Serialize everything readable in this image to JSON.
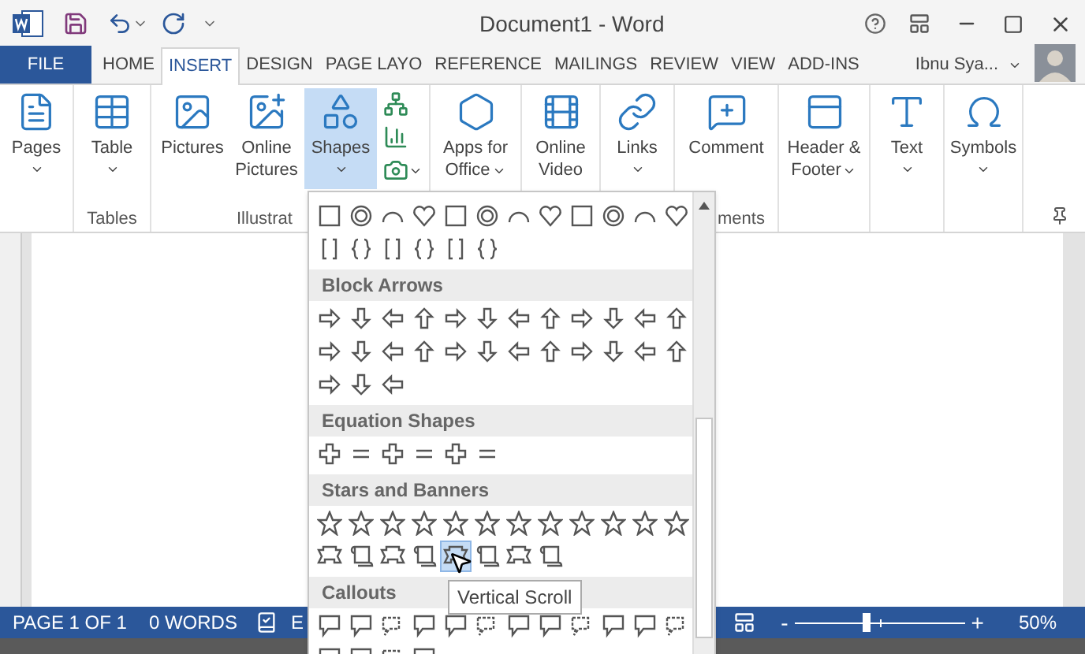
{
  "window": {
    "title": "Document1 - Word"
  },
  "ribbon_tabs": [
    {
      "label": "FILE",
      "kind": "file",
      "selected": false
    },
    {
      "label": "HOME",
      "kind": "tab",
      "selected": false
    },
    {
      "label": "INSERT",
      "kind": "tab",
      "selected": true
    },
    {
      "label": "DESIGN",
      "kind": "tab",
      "selected": false
    },
    {
      "label": "PAGE LAYO",
      "kind": "tab",
      "selected": false
    },
    {
      "label": "REFERENCE",
      "kind": "tab",
      "selected": false
    },
    {
      "label": "MAILINGS",
      "kind": "tab",
      "selected": false
    },
    {
      "label": "REVIEW",
      "kind": "tab",
      "selected": false
    },
    {
      "label": "VIEW",
      "kind": "tab",
      "selected": false
    },
    {
      "label": "ADD-INS",
      "kind": "tab",
      "selected": false
    }
  ],
  "account": {
    "name": "Ibnu Sya..."
  },
  "ribbon_groups": [
    {
      "buttons": [
        {
          "kind": "large",
          "label": "Pages",
          "dropdown": true,
          "selected": false
        }
      ]
    },
    {
      "label": "Tables",
      "buttons": [
        {
          "kind": "large",
          "label": "Table",
          "dropdown": true,
          "selected": false
        }
      ]
    },
    {
      "label": "Illustrat",
      "buttons": [
        {
          "kind": "large",
          "label": "Pictures",
          "dropdown": false,
          "selected": false
        },
        {
          "kind": "large",
          "label": "Online Pictures",
          "dropdown": false,
          "selected": false
        },
        {
          "kind": "large",
          "label": "Shapes",
          "dropdown": true,
          "selected": true
        },
        {
          "kind": "small",
          "dropdown": false,
          "selected": false
        },
        {
          "kind": "small",
          "dropdown": false,
          "selected": false
        },
        {
          "kind": "small",
          "dropdown": true,
          "selected": false
        }
      ]
    },
    {
      "buttons": [
        {
          "kind": "wrapped",
          "label": "Apps for Office",
          "dropdown": true,
          "selected": false
        }
      ]
    },
    {
      "buttons": [
        {
          "kind": "large",
          "label": "Online Video",
          "dropdown": false,
          "selected": false
        }
      ]
    },
    {
      "buttons": [
        {
          "kind": "large",
          "label": "Links",
          "dropdown": true,
          "selected": false
        }
      ]
    },
    {
      "label": "ments",
      "buttons": [
        {
          "kind": "large",
          "label": "Comment",
          "dropdown": false,
          "selected": false
        }
      ]
    },
    {
      "buttons": [
        {
          "kind": "wrapped",
          "label": "Header & Footer",
          "dropdown": true,
          "selected": false
        }
      ]
    },
    {
      "buttons": [
        {
          "kind": "large",
          "label": "Text",
          "dropdown": true,
          "selected": false
        }
      ]
    },
    {
      "buttons": [
        {
          "kind": "large",
          "label": "Symbols",
          "dropdown": true,
          "selected": false
        }
      ]
    }
  ],
  "shape_gallery": {
    "sections": [
      {
        "rows": [
          [
            {
              "kind": "basic",
              "selected": false
            },
            {
              "kind": "basic",
              "selected": false
            },
            {
              "kind": "basic",
              "selected": false
            },
            {
              "kind": "basic",
              "selected": false
            },
            {
              "kind": "basic",
              "selected": false
            },
            {
              "kind": "basic",
              "selected": false
            },
            {
              "kind": "basic",
              "selected": false
            },
            {
              "kind": "basic",
              "selected": false
            },
            {
              "kind": "basic",
              "selected": false
            },
            {
              "kind": "basic",
              "selected": false
            },
            {
              "kind": "basic",
              "selected": false
            },
            {
              "kind": "basic",
              "selected": false
            }
          ],
          [
            {
              "kind": "bracket",
              "selected": false
            },
            {
              "kind": "bracket",
              "selected": false
            },
            {
              "kind": "bracket",
              "selected": false
            },
            {
              "kind": "bracket",
              "selected": false
            },
            {
              "kind": "bracket",
              "selected": false
            },
            {
              "kind": "bracket",
              "selected": false
            }
          ]
        ]
      },
      {
        "title": "Block Arrows",
        "rows": [
          [
            {
              "kind": "arrow",
              "selected": false
            },
            {
              "kind": "arrow",
              "selected": false
            },
            {
              "kind": "arrow",
              "selected": false
            },
            {
              "kind": "arrow",
              "selected": false
            },
            {
              "kind": "arrow",
              "selected": false
            },
            {
              "kind": "arrow",
              "selected": false
            },
            {
              "kind": "arrow",
              "selected": false
            },
            {
              "kind": "arrow",
              "selected": false
            },
            {
              "kind": "arrow",
              "selected": false
            },
            {
              "kind": "arrow",
              "selected": false
            },
            {
              "kind": "arrow",
              "selected": false
            },
            {
              "kind": "arrow",
              "selected": false
            }
          ],
          [
            {
              "kind": "arrow",
              "selected": false
            },
            {
              "kind": "arrow",
              "selected": false
            },
            {
              "kind": "arrow",
              "selected": false
            },
            {
              "kind": "arrow",
              "selected": false
            },
            {
              "kind": "arrow",
              "selected": false
            },
            {
              "kind": "arrow",
              "selected": false
            },
            {
              "kind": "arrow",
              "selected": false
            },
            {
              "kind": "arrow",
              "selected": false
            },
            {
              "kind": "arrow",
              "selected": false
            },
            {
              "kind": "arrow",
              "selected": false
            },
            {
              "kind": "arrow",
              "selected": false
            },
            {
              "kind": "arrow",
              "selected": false
            }
          ],
          [
            {
              "kind": "arrow",
              "selected": false
            },
            {
              "kind": "arrow",
              "selected": false
            },
            {
              "kind": "arrow",
              "selected": false
            }
          ]
        ]
      },
      {
        "title": "Equation Shapes",
        "rows": [
          [
            {
              "kind": "math",
              "selected": false
            },
            {
              "kind": "math",
              "selected": false
            },
            {
              "kind": "math",
              "selected": false
            },
            {
              "kind": "math",
              "selected": false
            },
            {
              "kind": "math",
              "selected": false
            },
            {
              "kind": "math",
              "selected": false
            }
          ]
        ]
      },
      {
        "title": "Stars and Banners",
        "rows": [
          [
            {
              "kind": "star",
              "selected": false
            },
            {
              "kind": "star",
              "selected": false
            },
            {
              "kind": "star",
              "selected": false
            },
            {
              "kind": "star",
              "selected": false
            },
            {
              "kind": "star",
              "selected": false
            },
            {
              "kind": "star",
              "selected": false
            },
            {
              "kind": "star",
              "selected": false
            },
            {
              "kind": "star",
              "selected": false
            },
            {
              "kind": "star",
              "selected": false
            },
            {
              "kind": "star",
              "selected": false
            },
            {
              "kind": "star",
              "selected": false
            },
            {
              "kind": "star",
              "selected": false
            }
          ],
          [
            {
              "kind": "banner",
              "selected": false
            },
            {
              "kind": "banner",
              "selected": false
            },
            {
              "kind": "banner",
              "selected": false
            },
            {
              "kind": "banner",
              "selected": false
            },
            {
              "kind": "banner",
              "selected": true
            },
            {
              "kind": "banner",
              "selected": false
            },
            {
              "kind": "banner",
              "selected": false
            },
            {
              "kind": "banner",
              "selected": false
            }
          ]
        ]
      },
      {
        "title": "Callouts",
        "rows": [
          [
            {
              "kind": "callout",
              "selected": false
            },
            {
              "kind": "callout",
              "selected": false
            },
            {
              "kind": "callout",
              "selected": false
            },
            {
              "kind": "callout",
              "selected": false
            },
            {
              "kind": "callout",
              "selected": false
            },
            {
              "kind": "callout",
              "selected": false
            },
            {
              "kind": "callout",
              "selected": false
            },
            {
              "kind": "callout",
              "selected": false
            },
            {
              "kind": "callout",
              "selected": false
            },
            {
              "kind": "callout",
              "selected": false
            },
            {
              "kind": "callout",
              "selected": false
            },
            {
              "kind": "callout",
              "selected": false
            }
          ],
          [
            {
              "kind": "callout",
              "selected": false
            },
            {
              "kind": "callout",
              "selected": false
            },
            {
              "kind": "callout",
              "selected": false
            },
            {
              "kind": "callout",
              "selected": false
            }
          ]
        ]
      }
    ]
  },
  "tooltip": {
    "text": "Vertical Scroll"
  },
  "status_bar": {
    "page": "PAGE 1 OF 1",
    "words": "0 WORDS",
    "language": "E",
    "zoom_out": "-",
    "zoom_in": "+",
    "zoom": {
      "level": 0.42
    },
    "zoom_text": "50%"
  }
}
